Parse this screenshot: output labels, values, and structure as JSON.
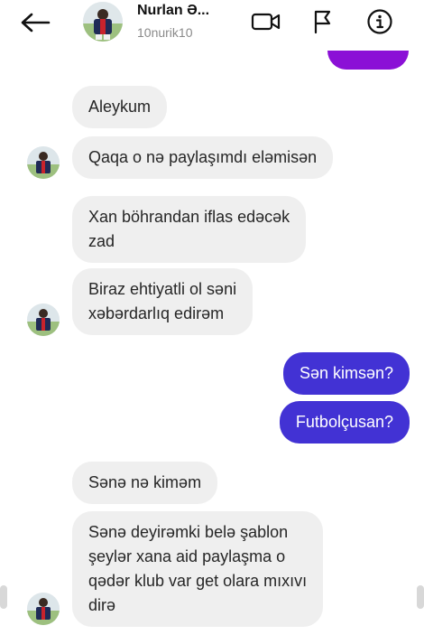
{
  "header": {
    "contact_name": "Nurlan Ə...",
    "username": "10nurik10",
    "icons": [
      "back-arrow-icon",
      "video-call-icon",
      "flag-icon",
      "info-icon"
    ]
  },
  "conversation": {
    "incoming_color": "#efefef",
    "outgoing_color": "#4232d4",
    "messages": [
      {
        "direction": "in",
        "lines": [
          "Aleykum"
        ]
      },
      {
        "direction": "in",
        "lines": [
          "Qaqa o nə paylaşımdı eləmisən"
        ]
      },
      {
        "direction": "in",
        "lines": [
          "Xan böhrandan iflas edəcək",
          "zad"
        ]
      },
      {
        "direction": "in",
        "lines": [
          "Biraz ehtiyatli ol səni",
          "xəbərdarlıq edirəm"
        ]
      },
      {
        "direction": "out",
        "lines": [
          "Sən kimsən?"
        ]
      },
      {
        "direction": "out",
        "lines": [
          "Futbolçusan?"
        ]
      },
      {
        "direction": "in",
        "lines": [
          "Sənə nə kiməm"
        ]
      },
      {
        "direction": "in",
        "lines": [
          "Sənə deyirəmki belə şablon",
          "şeylər xana aid paylaşma o",
          "qədər klub var get olara mıxıvı",
          "dirə"
        ]
      }
    ]
  }
}
